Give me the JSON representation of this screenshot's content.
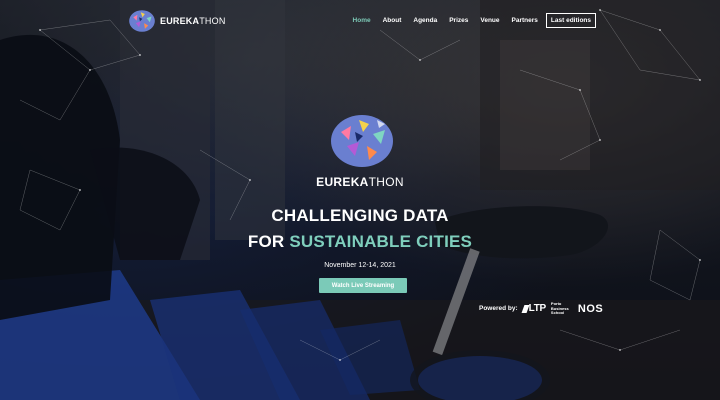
{
  "brand": {
    "bold": "EUREKA",
    "thin": "THON"
  },
  "nav": {
    "items": [
      {
        "label": "Home",
        "active": true
      },
      {
        "label": "About"
      },
      {
        "label": "Agenda"
      },
      {
        "label": "Prizes"
      },
      {
        "label": "Venue"
      },
      {
        "label": "Partners"
      }
    ],
    "last_editions": "Last editions"
  },
  "hero": {
    "title_line1": "CHALLENGING DATA",
    "title_line2_prefix": "FOR",
    "title_line2_accent": "SUSTAINABLE CITIES",
    "date": "November 12-14, 2021",
    "cta_label": "Watch Live Streaming"
  },
  "powered": {
    "label": "Powered by:",
    "sponsors": [
      {
        "name": "LTP"
      },
      {
        "name": "Porto Business School",
        "lines": [
          "Porto",
          "Business",
          "School"
        ]
      },
      {
        "name": "NOS"
      }
    ]
  },
  "colors": {
    "accent": "#7cc8b6",
    "bike_blue": "#2a55c8"
  },
  "icons": {
    "logo": "brain-logo-icon"
  }
}
